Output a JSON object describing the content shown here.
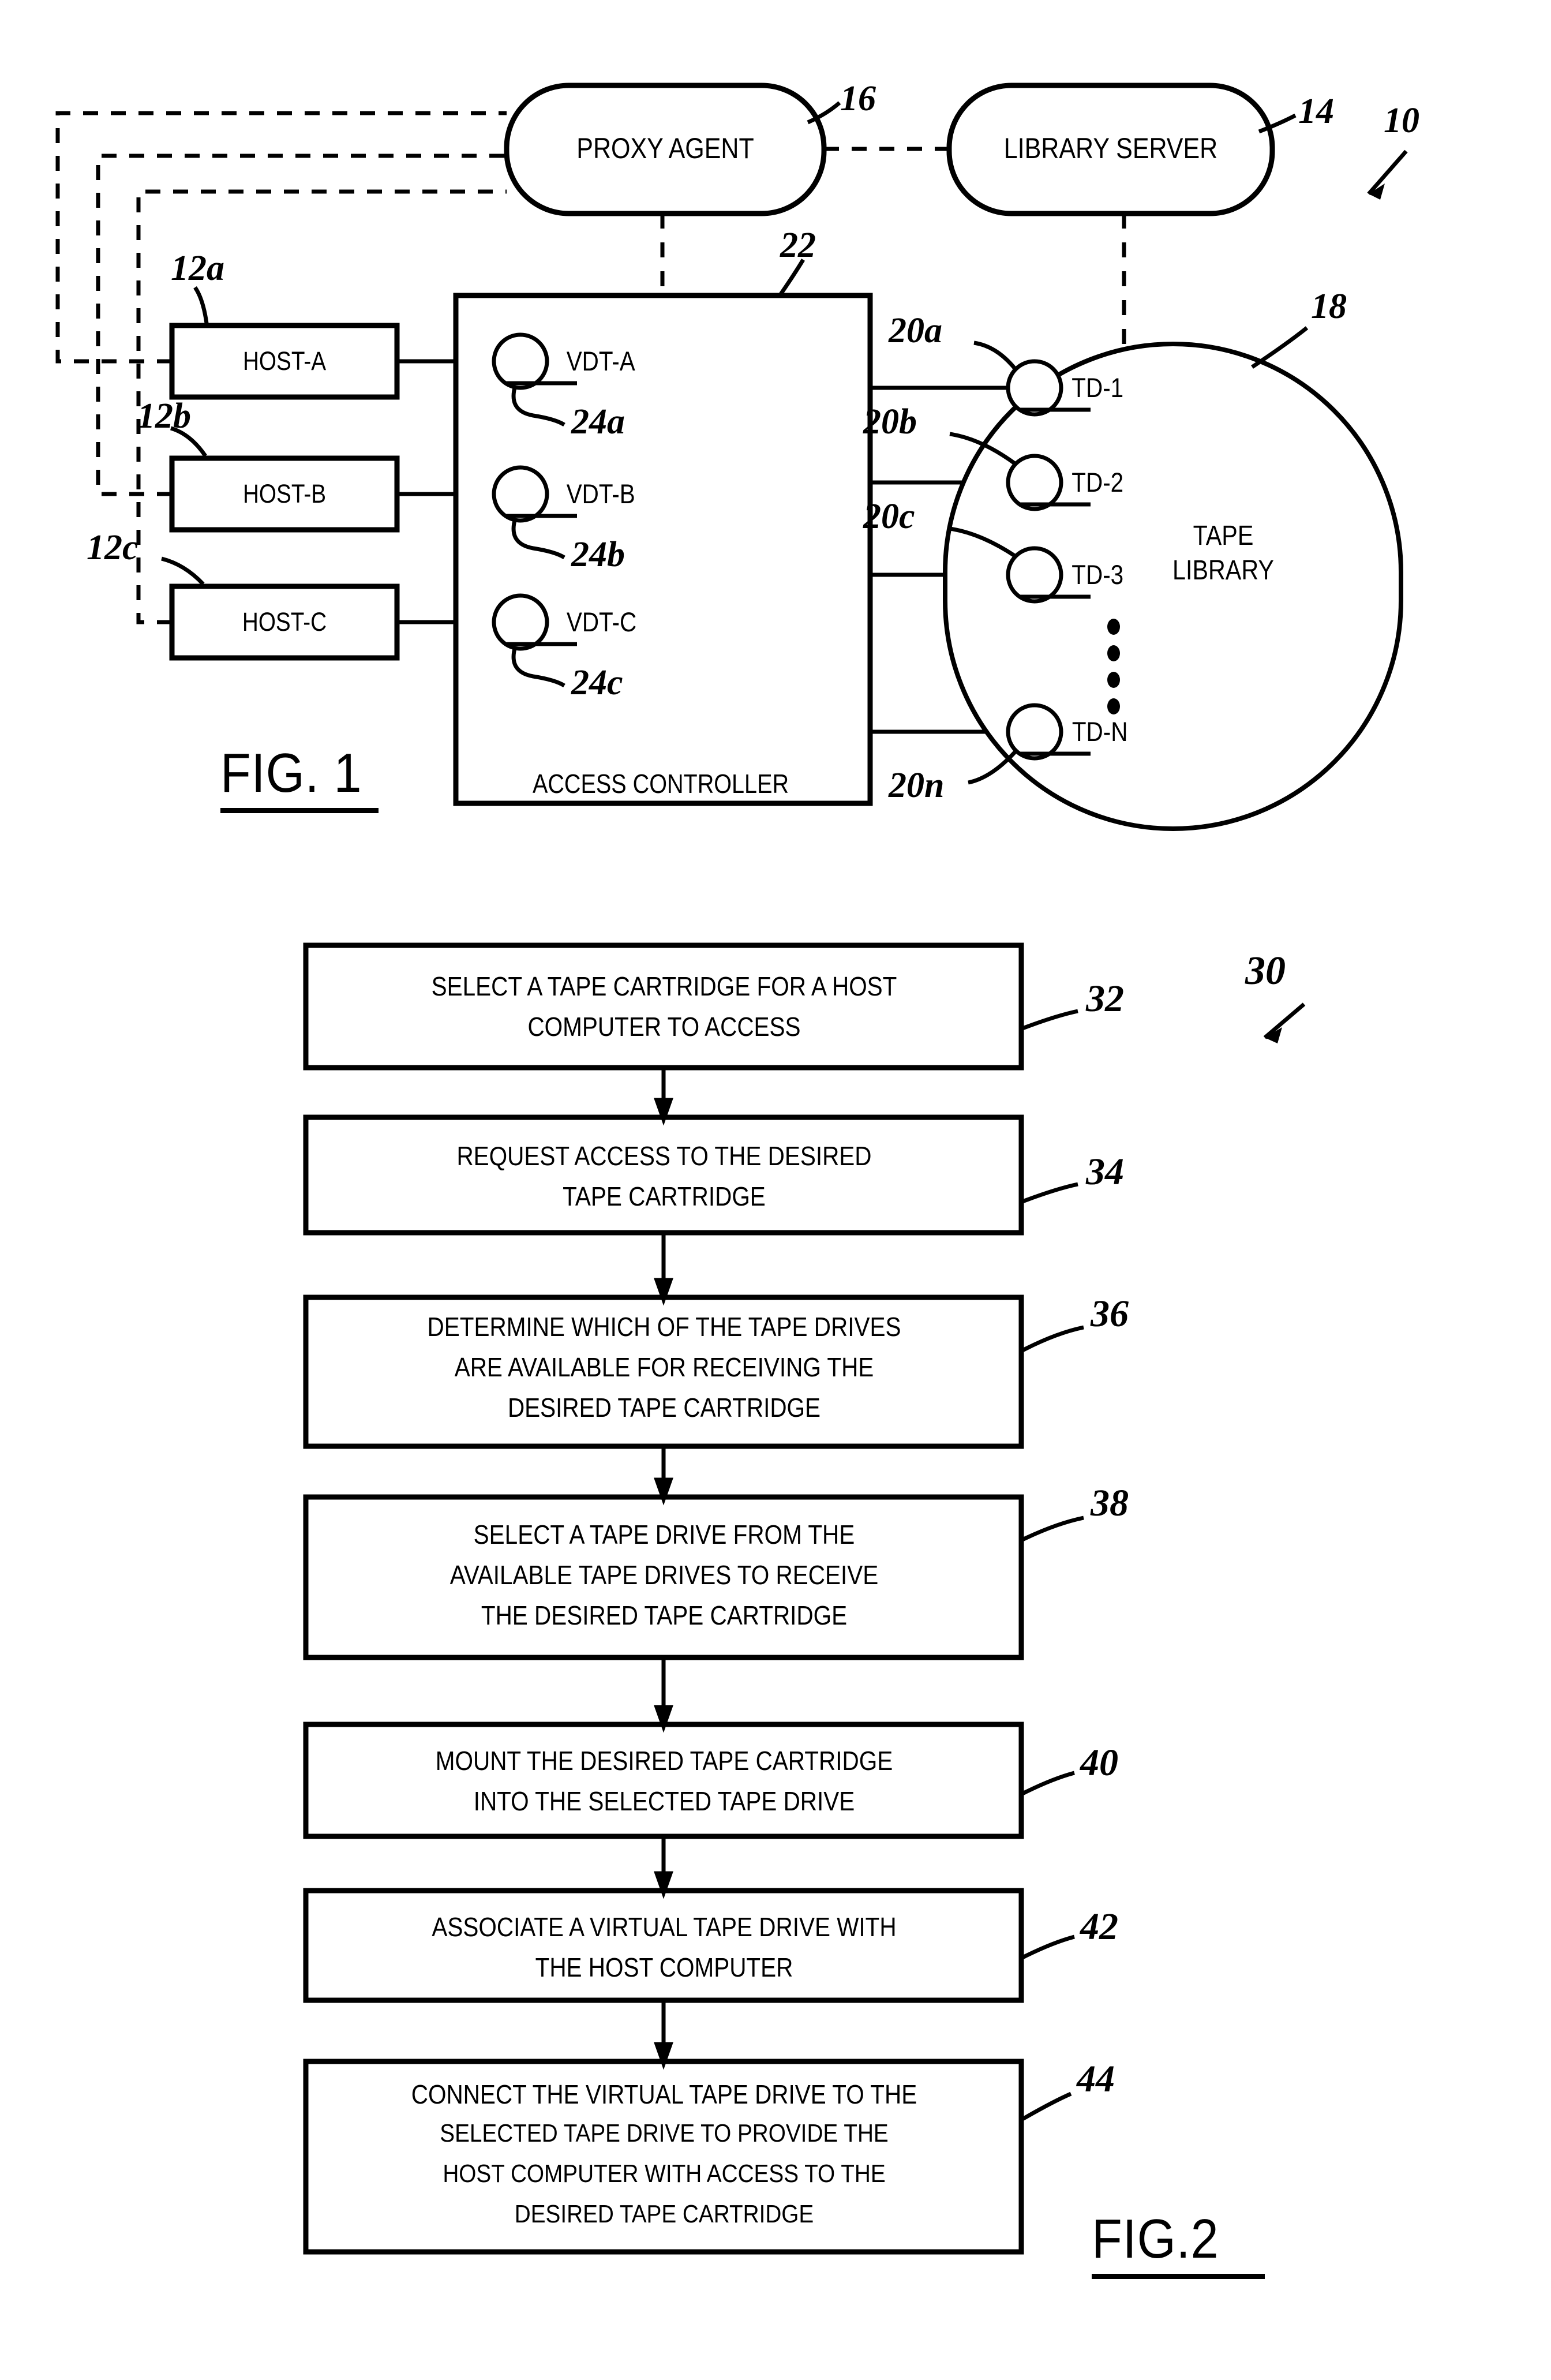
{
  "figure1": {
    "title": "FIG. 1",
    "system_ref": "10",
    "nodes": {
      "proxy_agent": {
        "label": "PROXY AGENT",
        "ref": "16"
      },
      "library_server": {
        "label": "LIBRARY SERVER",
        "ref": "14"
      },
      "access_controller": {
        "label": "ACCESS CONTROLLER",
        "ref": "22"
      },
      "tape_library": {
        "label_line1": "TAPE",
        "label_line2": "LIBRARY",
        "ref": "18"
      }
    },
    "hosts": [
      {
        "label": "HOST-A",
        "ref": "12a"
      },
      {
        "label": "HOST-B",
        "ref": "12b"
      },
      {
        "label": "HOST-C",
        "ref": "12c"
      }
    ],
    "virtual_drives": [
      {
        "label": "VDT-A",
        "ref": "24a"
      },
      {
        "label": "VDT-B",
        "ref": "24b"
      },
      {
        "label": "VDT-C",
        "ref": "24c"
      }
    ],
    "tape_drives": [
      {
        "label": "TD-1",
        "ref": "20a"
      },
      {
        "label": "TD-2",
        "ref": "20b"
      },
      {
        "label": "TD-3",
        "ref": "20c"
      },
      {
        "label": "TD-N",
        "ref": "20n"
      }
    ],
    "ellipsis": "vertical-dots"
  },
  "figure2": {
    "title": "FIG.2",
    "method_ref": "30",
    "steps": [
      {
        "ref": "32",
        "lines": [
          "SELECT A TAPE CARTRIDGE FOR A HOST",
          "COMPUTER TO ACCESS"
        ]
      },
      {
        "ref": "34",
        "lines": [
          "REQUEST ACCESS TO THE DESIRED",
          "TAPE CARTRIDGE"
        ]
      },
      {
        "ref": "36",
        "lines": [
          "DETERMINE WHICH OF THE TAPE DRIVES",
          "ARE AVAILABLE FOR RECEIVING THE",
          "DESIRED TAPE CARTRIDGE"
        ]
      },
      {
        "ref": "38",
        "lines": [
          "SELECT A TAPE DRIVE FROM THE",
          "AVAILABLE TAPE DRIVES TO RECEIVE",
          "THE DESIRED TAPE CARTRIDGE"
        ]
      },
      {
        "ref": "40",
        "lines": [
          "MOUNT THE DESIRED TAPE CARTRIDGE",
          "INTO THE SELECTED TAPE DRIVE"
        ]
      },
      {
        "ref": "42",
        "lines": [
          "ASSOCIATE A VIRTUAL TAPE DRIVE WITH",
          "THE HOST COMPUTER"
        ]
      },
      {
        "ref": "44",
        "lines": [
          "CONNECT THE VIRTUAL TAPE DRIVE TO THE",
          "SELECTED TAPE DRIVE TO PROVIDE THE",
          "HOST COMPUTER WITH ACCESS TO THE",
          "DESIRED TAPE CARTRIDGE"
        ]
      }
    ]
  },
  "colors": {
    "ink": "#000000",
    "paper": "#ffffff"
  }
}
